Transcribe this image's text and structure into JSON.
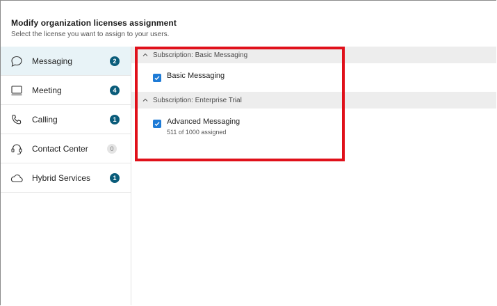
{
  "header": {
    "title": "Modify organization licenses assignment",
    "subtitle": "Select the license you want to assign to your users."
  },
  "sidebar": {
    "items": [
      {
        "label": "Messaging",
        "icon": "chat-bubble-icon",
        "count": "2",
        "active": true
      },
      {
        "label": "Meeting",
        "icon": "monitor-icon",
        "count": "4",
        "active": false
      },
      {
        "label": "Calling",
        "icon": "phone-icon",
        "count": "1",
        "active": false
      },
      {
        "label": "Contact Center",
        "icon": "headset-icon",
        "count": "0",
        "active": false
      },
      {
        "label": "Hybrid Services",
        "icon": "cloud-icon",
        "count": "1",
        "active": false
      }
    ]
  },
  "subscriptions": [
    {
      "header": "Subscription: Basic Messaging",
      "licenses": [
        {
          "name": "Basic Messaging",
          "checked": true,
          "meta": ""
        }
      ]
    },
    {
      "header": "Subscription: Enterprise Trial",
      "licenses": [
        {
          "name": "Advanced Messaging",
          "checked": true,
          "meta": "511 of 1000 assigned"
        }
      ]
    }
  ],
  "colors": {
    "accent": "#1e7bd6",
    "badge": "#0a5c7a",
    "active_bg": "#e8f3f7",
    "highlight": "#e0101a"
  }
}
